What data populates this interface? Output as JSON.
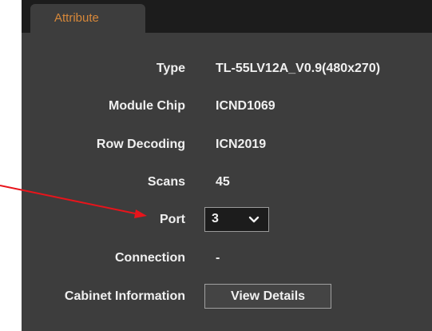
{
  "tab": {
    "label": "Attribute"
  },
  "attributes": {
    "type_label": "Type",
    "type_value": "TL-55LV12A_V0.9(480x270)",
    "module_chip_label": "Module Chip",
    "module_chip_value": "ICND1069",
    "row_decoding_label": "Row Decoding",
    "row_decoding_value": "ICN2019",
    "scans_label": "Scans",
    "scans_value": "45",
    "port_label": "Port",
    "port_value": "3",
    "connection_label": "Connection",
    "connection_value": "-",
    "cabinet_label": "Cabinet Information",
    "cabinet_button": "View Details"
  },
  "icons": {
    "dropdown": "chevron-down-icon",
    "annotation": "red-arrow-annotation"
  },
  "colors": {
    "panel_bg": "#3d3d3d",
    "tabbar_bg": "#1c1c1c",
    "tab_text": "#d7883a",
    "text": "#f0f0f0",
    "annotation": "#e8141b"
  }
}
